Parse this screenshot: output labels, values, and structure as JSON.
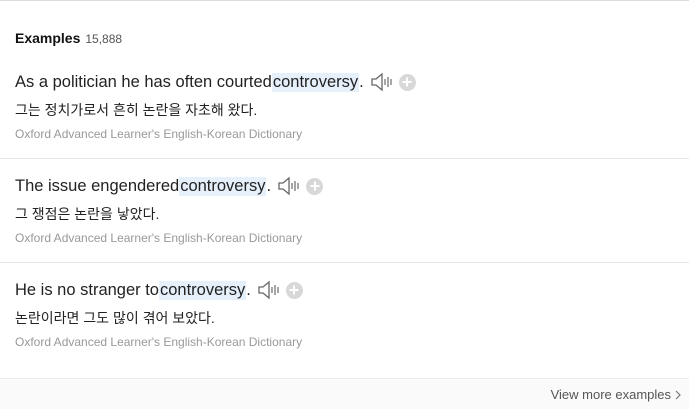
{
  "header": {
    "title": "Examples",
    "count": "15,888"
  },
  "examples": [
    {
      "before": "As a politician he has often courted ",
      "highlight": "controversy",
      "after": ".",
      "translation": "그는 정치가로서 흔히 논란을 자초해 왔다.",
      "source": "Oxford Advanced Learner's English-Korean Dictionary"
    },
    {
      "before": "The issue engendered ",
      "highlight": "controversy",
      "after": ".",
      "translation": "그 쟁점은 논란을 낳았다.",
      "source": "Oxford Advanced Learner's English-Korean Dictionary"
    },
    {
      "before": "He is no stranger to ",
      "highlight": "controversy",
      "after": ".",
      "translation": "논란이라면 그도 많이 겪어 보았다.",
      "source": "Oxford Advanced Learner's English-Korean Dictionary"
    }
  ],
  "footer": {
    "view_more_label": "View more examples"
  },
  "icons": {
    "audio": "speaker-icon",
    "add": "plus-circle-icon",
    "more": "chevron-right-icon"
  },
  "colors": {
    "highlight": "#e6f0fb",
    "source_text": "#999999"
  }
}
